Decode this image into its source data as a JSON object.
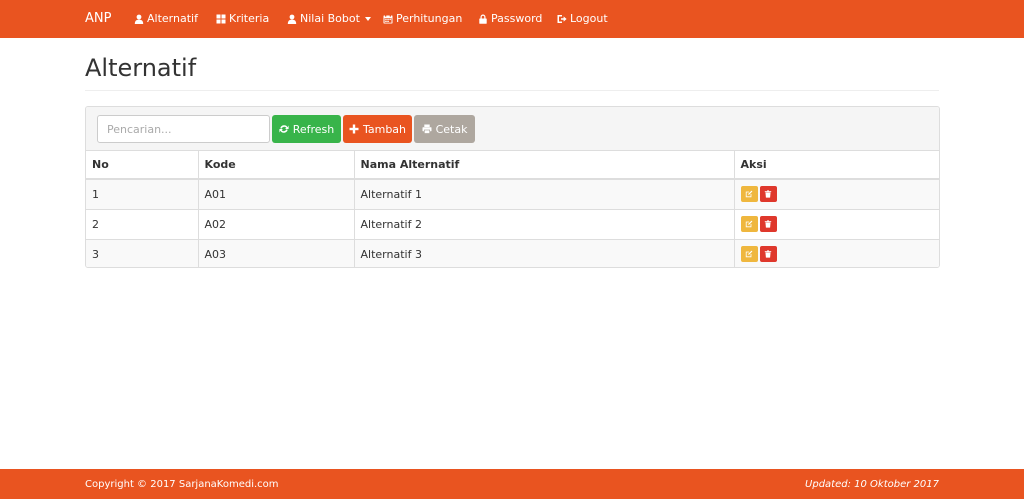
{
  "navbar": {
    "brand": "ANP",
    "items": [
      {
        "label": "Alternatif",
        "icon": "user-icon"
      },
      {
        "label": "Kriteria",
        "icon": "th-large-icon"
      },
      {
        "label": "Nilai Bobot",
        "icon": "user-icon",
        "dropdown": true
      },
      {
        "label": "Perhitungan",
        "icon": "calendar-icon"
      },
      {
        "label": "Password",
        "icon": "lock-icon"
      },
      {
        "label": "Logout",
        "icon": "logout-icon"
      }
    ]
  },
  "page": {
    "title": "Alternatif"
  },
  "toolbar": {
    "search_placeholder": "Pencarian...",
    "refresh_label": "Refresh",
    "tambah_label": "Tambah",
    "cetak_label": "Cetak"
  },
  "table": {
    "headers": [
      "No",
      "Kode",
      "Nama Alternatif",
      "Aksi"
    ],
    "rows": [
      {
        "no": "1",
        "kode": "A01",
        "nama": "Alternatif 1"
      },
      {
        "no": "2",
        "kode": "A02",
        "nama": "Alternatif 2"
      },
      {
        "no": "3",
        "kode": "A03",
        "nama": "Alternatif 3"
      }
    ]
  },
  "footer": {
    "copyright": "Copyright © 2017 SarjanaKomedi.com",
    "updated": "Updated: 10 Oktober 2017"
  },
  "colors": {
    "primary": "#e95420",
    "success": "#38b44a",
    "muted": "#aea79f",
    "warning": "#efb73e",
    "danger": "#df382c"
  }
}
